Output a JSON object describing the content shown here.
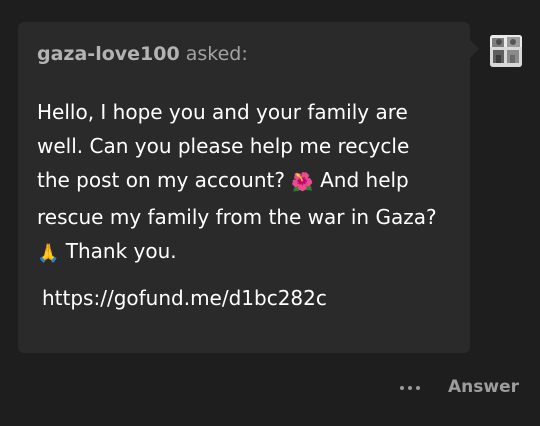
{
  "ask": {
    "asker_name": "gaza-love100",
    "asked_label": "asked:",
    "line1": "Hello, I hope you and your family are",
    "line2": "well. Can you please help me recycle",
    "line3": "the post on my account?",
    "hibiscus_emoji": "🌺",
    "line3b": "And help",
    "line4": "rescue my family from the war in Gaza?",
    "pray_emoji": "🙏",
    "line5": "Thank you.",
    "link": "https://gofund.me/d1bc282c"
  },
  "avatar": {
    "icon": "user-avatar"
  },
  "actions": {
    "more_icon": "ellipsis-icon",
    "answer_label": "Answer"
  },
  "colors": {
    "background": "#1e1e1e",
    "card": "#2a2a2a",
    "text": "#ffffff",
    "muted": "#a3a3a3"
  }
}
